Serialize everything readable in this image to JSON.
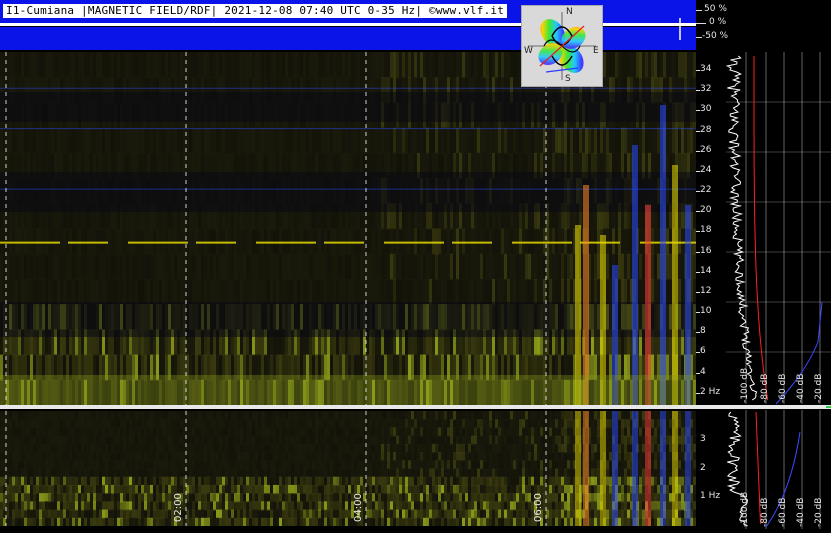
{
  "header": {
    "title": "I1-Cumiana |MAGNETIC FIELD/RDF| 2021-12-08 07:40 UTC 0-35 Hz| ©www.vlf.it",
    "percent_labels": [
      "50 %",
      "0 %",
      "-50 %"
    ]
  },
  "compass": {
    "directions": [
      "N",
      "E",
      "S",
      "W"
    ]
  },
  "chart_data": {
    "type": "heatmap",
    "title": "I1-Cumiana |MAGNETIC FIELD/RDF| 2021-12-08 07:40 UTC 0-35 Hz| ©www.vlf.it",
    "xlabel": "",
    "ylabel": "Hz",
    "x_ticks": [
      "02:00",
      "04:00",
      "06:00"
    ],
    "upper_panel": {
      "y_range_hz": [
        0,
        35
      ],
      "y_ticks": [
        "34",
        "32",
        "30",
        "28",
        "26",
        "24",
        "22",
        "20",
        "18",
        "16",
        "14",
        "12",
        "10",
        "8",
        "6",
        "4",
        "2 Hz"
      ],
      "db_ticks": [
        "-100 dB",
        "-80 dB",
        "-60 dB",
        "-40 dB",
        "-20 dB"
      ]
    },
    "lower_panel": {
      "y_range_hz": [
        0,
        4
      ],
      "y_ticks": [
        "3",
        "2",
        "1 Hz"
      ],
      "db_ticks": [
        "-100 dB",
        "-80 dB",
        "-60 dB",
        "-40 dB",
        "-20 dB"
      ]
    },
    "grid": true,
    "colors": {
      "background": "#0b0b06",
      "low_signal": "#3a3a10",
      "mid_signal": "#8a9a1a",
      "high_signal": "#e6d800",
      "blue_burst": "#2a4aff",
      "red_marker": "#ff2020",
      "header_band": "#0a14e8"
    }
  }
}
